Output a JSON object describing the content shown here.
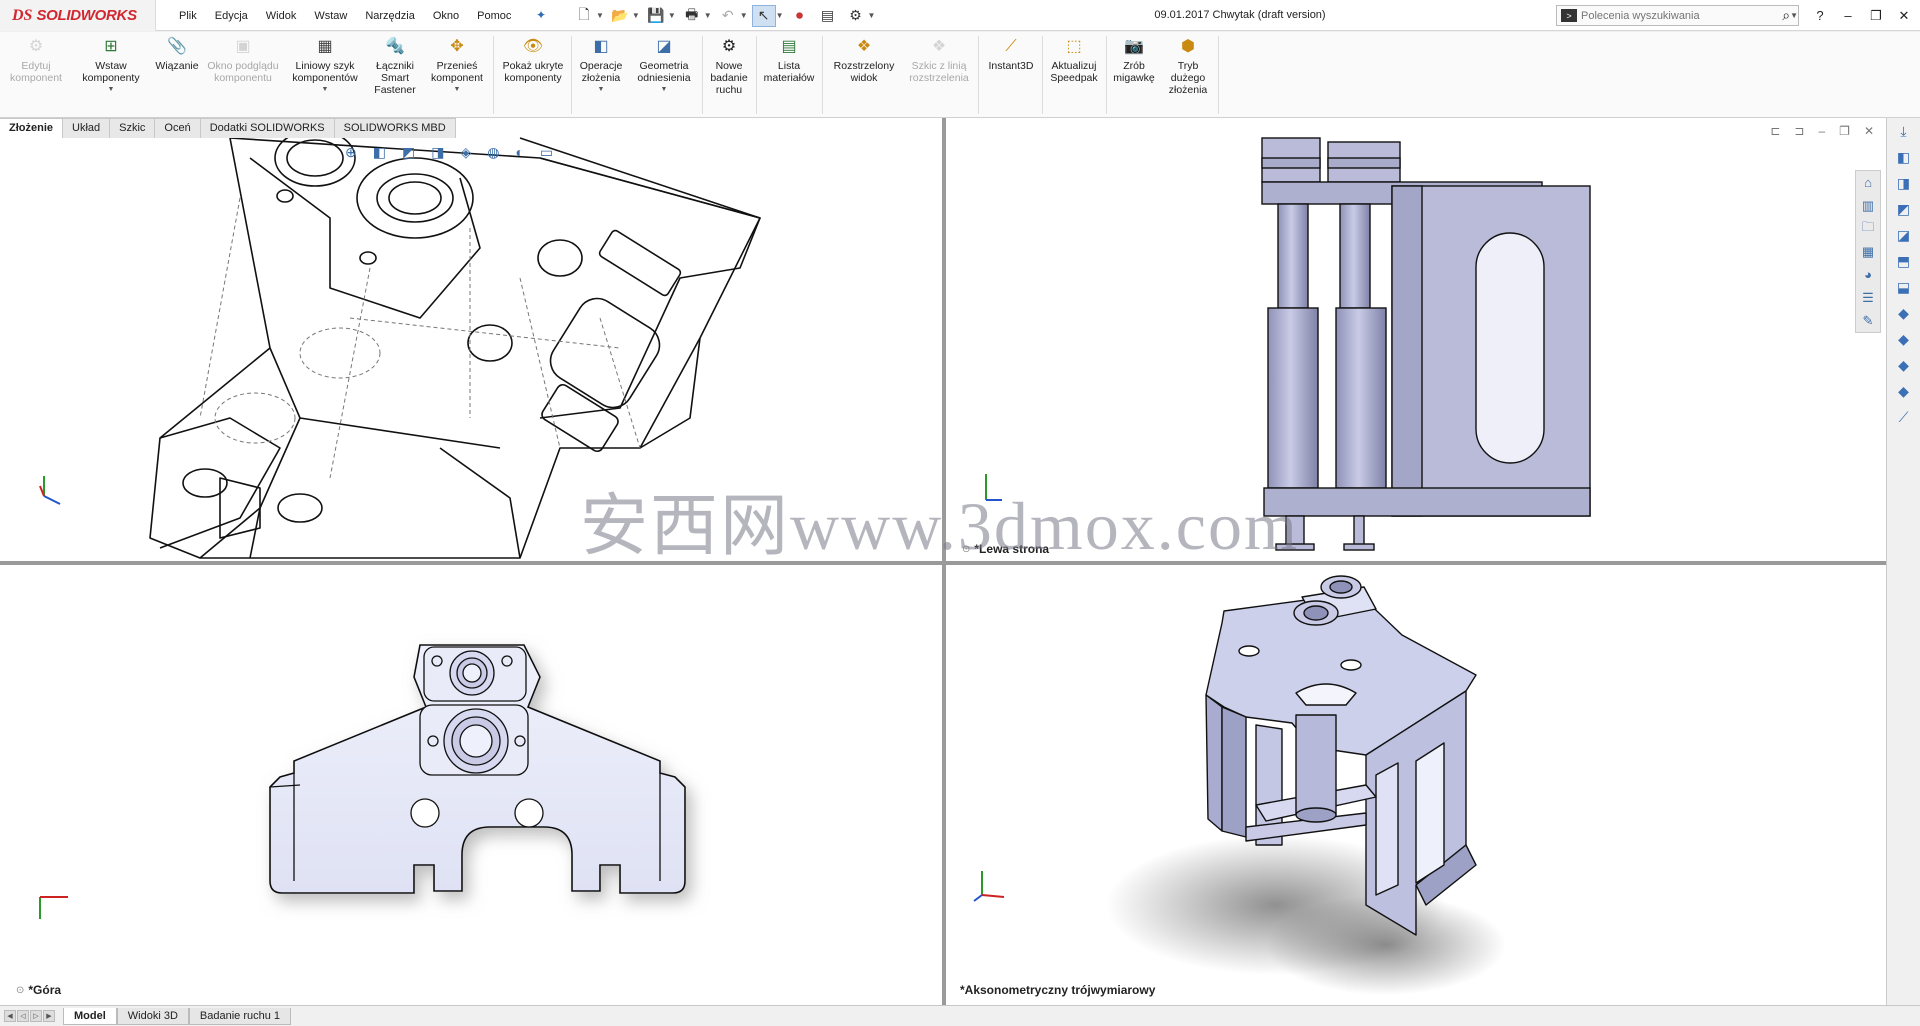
{
  "app": {
    "brand_prefix": "DS",
    "brand_name": "SOLIDWORKS"
  },
  "menu": [
    "Plik",
    "Edycja",
    "Widok",
    "Wstaw",
    "Narzędzia",
    "Okno",
    "Pomoc"
  ],
  "doc_title": "09.01.2017 Chwytak (draft version)",
  "search": {
    "placeholder": "Polecenia wyszukiwania"
  },
  "commands": [
    {
      "label": "Edytuj komponent",
      "icon": "edit-component-icon",
      "enabled": false
    },
    {
      "label": "Wstaw komponenty",
      "icon": "insert-components-icon",
      "enabled": true
    },
    {
      "label": "Wiązanie",
      "icon": "mate-icon",
      "enabled": true
    },
    {
      "label": "Okno podglądu komponentu",
      "icon": "component-preview-icon",
      "enabled": false
    },
    {
      "label": "Liniowy szyk komponentów",
      "icon": "linear-pattern-icon",
      "enabled": true
    },
    {
      "label": "Łączniki Smart Fastener",
      "icon": "smart-fastener-icon",
      "enabled": true
    },
    {
      "label": "Przenieś komponent",
      "icon": "move-component-icon",
      "enabled": true
    },
    {
      "label": "Pokaż ukryte komponenty",
      "icon": "show-hidden-icon",
      "enabled": true
    },
    {
      "label": "Operacje złożenia",
      "icon": "assembly-features-icon",
      "enabled": true
    },
    {
      "label": "Geometria odniesienia",
      "icon": "reference-geometry-icon",
      "enabled": true
    },
    {
      "label": "Nowe badanie ruchu",
      "icon": "motion-study-icon",
      "enabled": true
    },
    {
      "label": "Lista materiałów",
      "icon": "bom-icon",
      "enabled": true
    },
    {
      "label": "Rozstrzelony widok",
      "icon": "exploded-view-icon",
      "enabled": true
    },
    {
      "label": "Szkic z linią rozstrzelenia",
      "icon": "explode-line-sketch-icon",
      "enabled": false
    },
    {
      "label": "Instant3D",
      "icon": "instant3d-icon",
      "enabled": true
    },
    {
      "label": "Aktualizuj Speedpak",
      "icon": "speedpak-icon",
      "enabled": true
    },
    {
      "label": "Zrób migawkę",
      "icon": "snapshot-icon",
      "enabled": true
    },
    {
      "label": "Tryb dużego złożenia",
      "icon": "large-assembly-icon",
      "enabled": true
    }
  ],
  "command_tabs": [
    "Złożenie",
    "Układ",
    "Szkic",
    "Oceń",
    "Dodatki SOLIDWORKS",
    "SOLIDWORKS MBD"
  ],
  "views": {
    "top_right": "*Lewa strona",
    "bottom_left": "*Góra",
    "bottom_right": "*Aksonometryczny trójwymiarowy"
  },
  "watermark": "安西网www.3dmox.com",
  "bottom_tabs": [
    "Model",
    "Widoki 3D",
    "Badanie ruchu 1"
  ],
  "colors": {
    "brand": "#d22630",
    "part_fill": "#c9cbe6",
    "part_fill_light": "#e6e8f7",
    "edge": "#111111"
  }
}
